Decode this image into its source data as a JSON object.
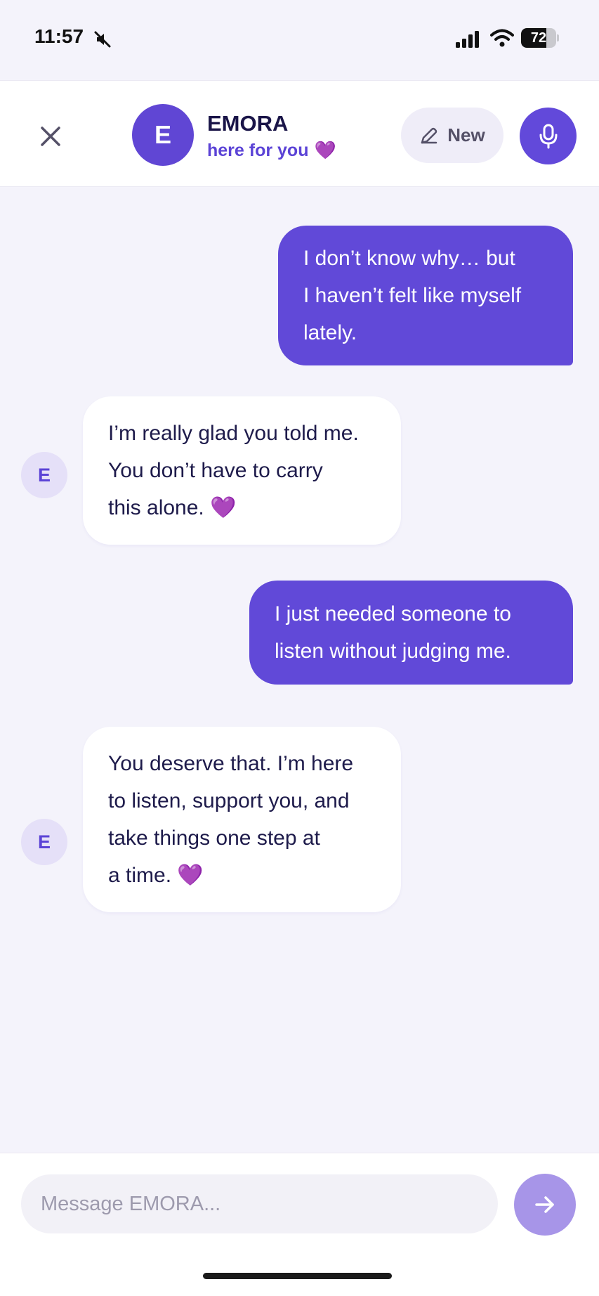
{
  "status_bar": {
    "time": "11:57",
    "battery_level": "72",
    "battery_fraction": 0.72,
    "icons": [
      "mute-icon",
      "cellular-signal-icon",
      "wifi-icon",
      "battery-icon"
    ]
  },
  "header": {
    "close_icon": "close-icon",
    "avatar_letter": "E",
    "name": "EMORA",
    "subtitle": "here for you",
    "subtitle_emoji": "💜",
    "new_button_label": "New",
    "new_button_icon": "pencil-icon",
    "mic_icon": "microphone-icon"
  },
  "messages": [
    {
      "sender": "user",
      "lines": [
        "I don’t know why… but",
        "I haven’t felt like myself",
        "lately."
      ]
    },
    {
      "sender": "bot",
      "avatar_letter": "E",
      "lines": [
        "I’m really glad you told me.",
        "You don’t have to carry",
        "this alone. 💜"
      ]
    },
    {
      "sender": "user",
      "lines": [
        "I just needed someone to",
        "listen without judging me."
      ]
    },
    {
      "sender": "bot",
      "avatar_letter": "E",
      "lines": [
        "You deserve that. I’m here",
        "to listen, support you, and",
        "take things one step at",
        "a time. 💜"
      ]
    }
  ],
  "composer": {
    "placeholder": "Message EMORA...",
    "value": "",
    "send_icon": "arrow-right-icon"
  },
  "colors": {
    "accent": "#6149d8",
    "background": "#f4f3fb",
    "bot_avatar_bg": "#e5e0f8",
    "send_button": "#a795e8"
  }
}
